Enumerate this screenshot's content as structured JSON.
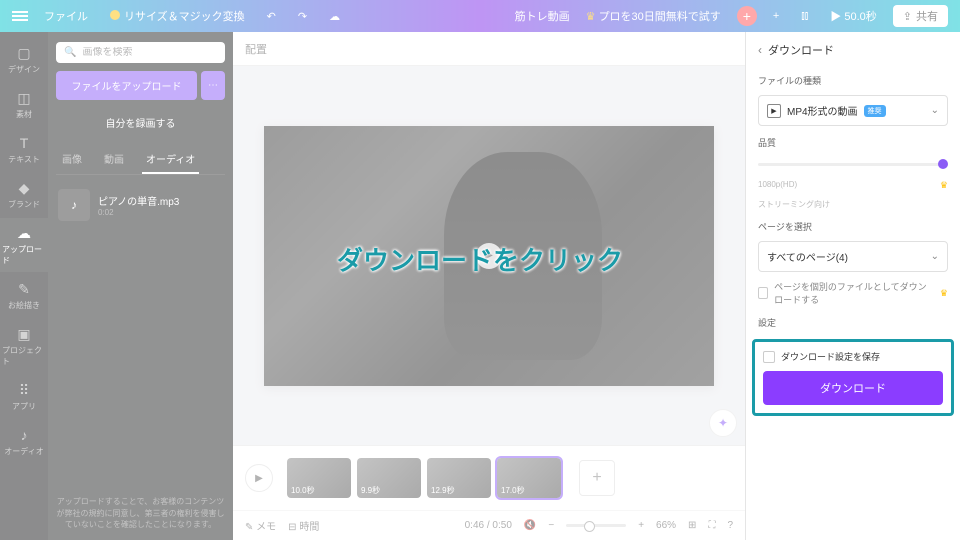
{
  "topbar": {
    "file": "ファイル",
    "resize": "リサイズ＆マジック変換",
    "project_title": "筋トレ動画",
    "pro_trial": "プロを30日間無料で試す",
    "duration": "50.0秒",
    "share": "共有"
  },
  "leftrail": {
    "items": [
      {
        "label": "デザイン",
        "icon": "▢"
      },
      {
        "label": "素材",
        "icon": "◫"
      },
      {
        "label": "テキスト",
        "icon": "T"
      },
      {
        "label": "ブランド",
        "icon": "◆"
      },
      {
        "label": "アップロード",
        "icon": "☁",
        "active": true
      },
      {
        "label": "お絵描き",
        "icon": "✎"
      },
      {
        "label": "プロジェクト",
        "icon": "▣"
      },
      {
        "label": "アプリ",
        "icon": "⠿"
      },
      {
        "label": "オーディオ",
        "icon": "♪"
      }
    ]
  },
  "sidepanel": {
    "search_placeholder": "画像を検索",
    "upload_btn": "ファイルをアップロード",
    "record_btn": "自分を録画する",
    "tabs": [
      "画像",
      "動画",
      "オーディオ"
    ],
    "active_tab": 2,
    "audio": {
      "name": "ピアノの単音.mp3",
      "duration": "0:02"
    },
    "footer": "アップロードすることで、お客様のコンテンツが弊社の規約に同意し、第三者の権利を侵害していないことを確認したことになります。"
  },
  "canvas": {
    "toolbar_label": "配置",
    "annotation": "ダウンロードをクリック"
  },
  "timeline": {
    "clips": [
      {
        "dur": "10.0秒"
      },
      {
        "dur": "9.9秒"
      },
      {
        "dur": "12.9秒"
      },
      {
        "dur": "17.0秒",
        "selected": true
      }
    ],
    "notes": "メモ",
    "duration_label": "時間",
    "time": "0:46 / 0:50",
    "zoom": "66%"
  },
  "download": {
    "title": "ダウンロード",
    "filetype_label": "ファイルの種類",
    "filetype": "MP4形式の動画",
    "filetype_badge": "推奨",
    "quality_label": "品質",
    "quality_value": "1080p(HD)",
    "quality_note": "ストリーミング向け",
    "pages_label": "ページを選択",
    "pages_value": "すべてのページ(4)",
    "separate_files": "ページを個別のファイルとしてダウンロードする",
    "settings_label": "設定",
    "save_settings": "ダウンロード設定を保存",
    "download_btn": "ダウンロード"
  }
}
